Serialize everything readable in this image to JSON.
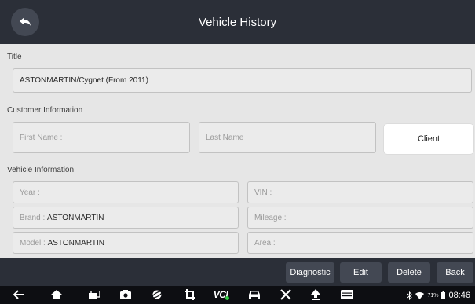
{
  "header": {
    "title": "Vehicle History"
  },
  "form": {
    "title_label": "Title",
    "title_value": "ASTONMARTIN/Cygnet (From 2011)",
    "customer_label": "Customer Information",
    "first_name_label": "First Name :",
    "first_name_value": "",
    "last_name_label": "Last Name :",
    "last_name_value": "",
    "client_button": "Client",
    "vehicle_label": "Vehicle Information",
    "year_label": "Year :",
    "year_value": "",
    "vin_label": "VIN :",
    "vin_value": "",
    "brand_label": "Brand : ",
    "brand_value": "ASTONMARTIN",
    "mileage_label": "Mileage :",
    "mileage_value": "",
    "model_label": "Model : ",
    "model_value": "ASTONMARTIN",
    "area_label": "Area :",
    "area_value": ""
  },
  "actions": {
    "diagnostic": "Diagnostic",
    "edit": "Edit",
    "delete": "Delete",
    "back": "Back"
  },
  "system_bar": {
    "icons": [
      "back-icon",
      "home-icon",
      "recent-apps-icon",
      "camera-icon",
      "browser-icon",
      "screenshot-crop-icon",
      "vci-icon",
      "car-icon",
      "tools-icon",
      "upload-icon",
      "menu-icon"
    ],
    "vci_text": "VCI",
    "battery_percent": "71%",
    "time": "08:46"
  },
  "colors": {
    "header_bg": "#2b2f38",
    "content_bg": "#e6e6e6",
    "field_bg": "#ebebeb",
    "field_border": "#c2c2c2",
    "button_bg": "#434853",
    "vci_accent": "#2ecc40",
    "system_bar_bg": "#0d0e12"
  }
}
